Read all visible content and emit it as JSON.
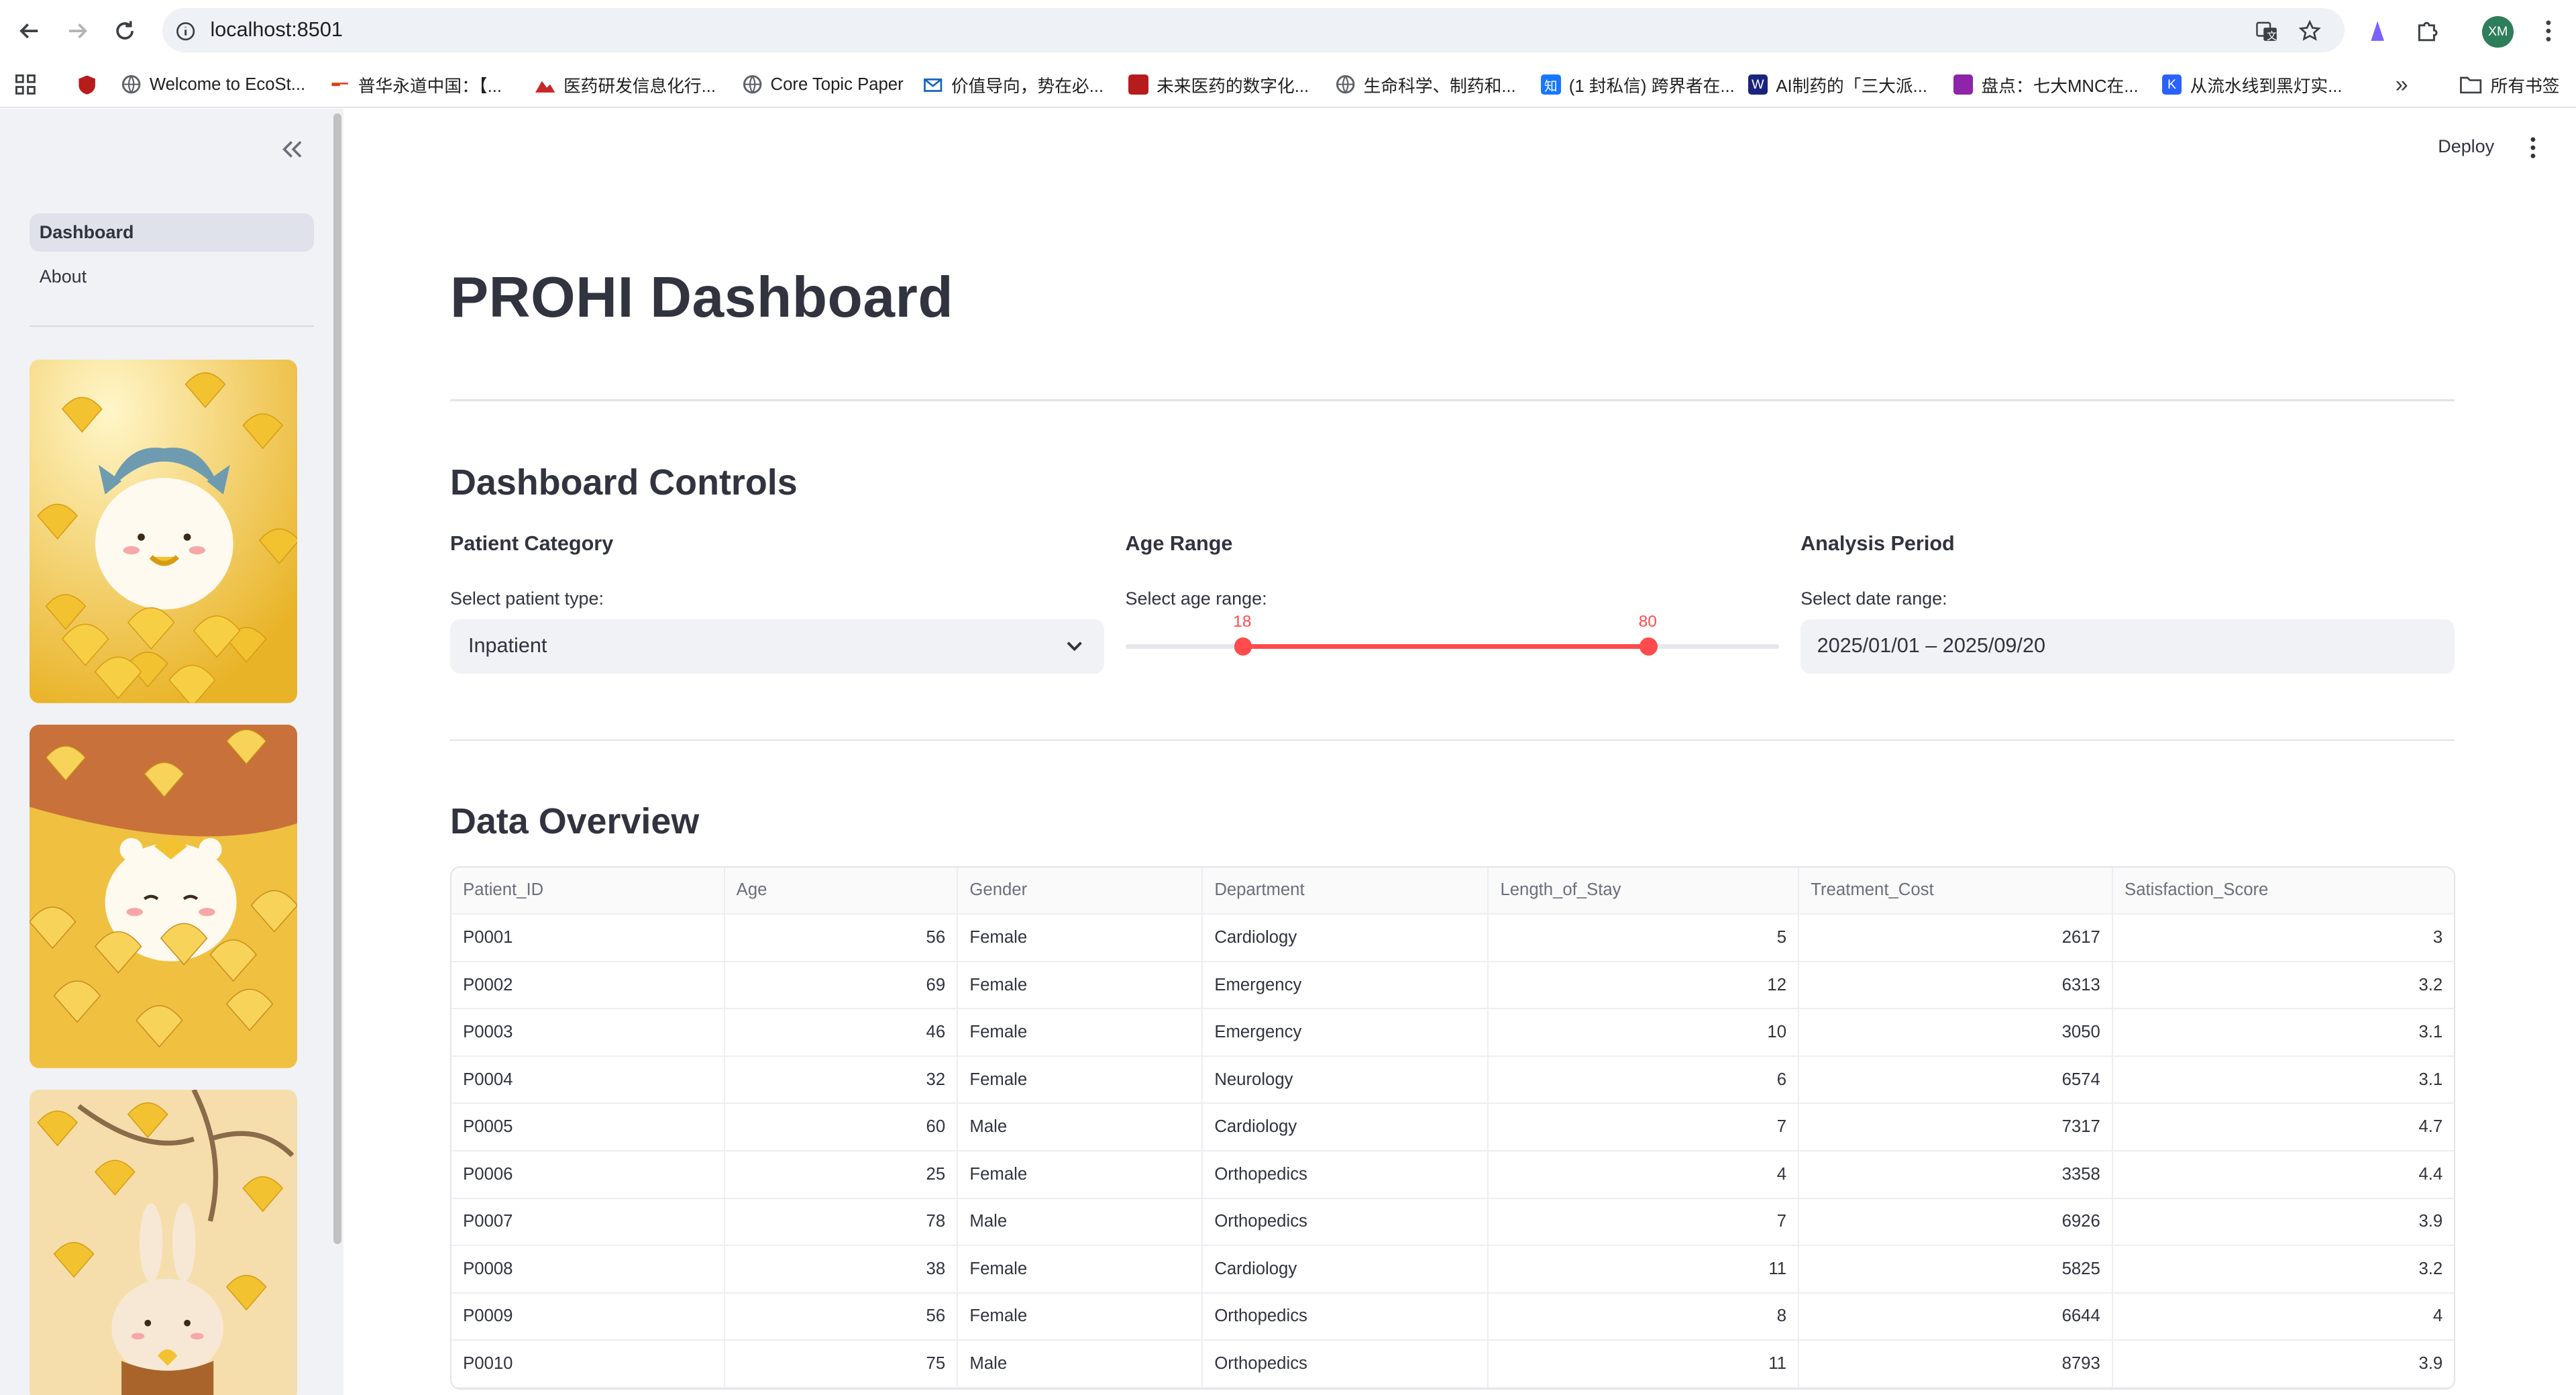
{
  "browser": {
    "url": "localhost:8501",
    "avatar_initials": "XM",
    "bookmarks": [
      {
        "label": "Welcome to EcoSt...",
        "icon": "globe-icon",
        "color": "#5f6368"
      },
      {
        "label": "普华永道中国：【...",
        "icon": "pwc-icon",
        "color": "#d93f0b"
      },
      {
        "label": "医药研发信息化行...",
        "icon": "mountain-icon",
        "color": "#c62828"
      },
      {
        "label": "Core Topic Paper",
        "icon": "globe-icon",
        "color": "#5f6368"
      },
      {
        "label": "价值导向，势在必...",
        "icon": "mail-icon",
        "color": "#1565c0"
      },
      {
        "label": "未来医药的数字化...",
        "icon": "logo-icon",
        "color": "#b71c1c"
      },
      {
        "label": "生命科学、制药和...",
        "icon": "globe-icon",
        "color": "#5f6368"
      },
      {
        "label": "(1 封私信) 跨界者在...",
        "icon": "zhihu-icon",
        "color": "#1677ff"
      },
      {
        "label": "AI制药的「三大派...",
        "icon": "w-icon",
        "color": "#1a237e"
      },
      {
        "label": "盘点：七大MNC在...",
        "icon": "logo-icon",
        "color": "#8e24aa"
      },
      {
        "label": "从流水线到黑灯实...",
        "icon": "k-icon",
        "color": "#2962ff"
      }
    ],
    "all_bookmarks": "所有书签"
  },
  "sidebar": {
    "nav": [
      {
        "label": "Dashboard",
        "active": true
      },
      {
        "label": "About",
        "active": false
      }
    ]
  },
  "header": {
    "deploy": "Deploy"
  },
  "main": {
    "title": "PROHI Dashboard",
    "controls_heading": "Dashboard Controls",
    "patient_category": {
      "heading": "Patient Category",
      "label": "Select patient type:",
      "value": "Inpatient"
    },
    "age_range": {
      "heading": "Age Range",
      "label": "Select age range:",
      "min": 0,
      "max": 100,
      "low": 18,
      "high": 80
    },
    "analysis_period": {
      "heading": "Analysis Period",
      "label": "Select date range:",
      "value": "2025/01/01 – 2025/09/20"
    },
    "overview_heading": "Data Overview",
    "table": {
      "columns": [
        "Patient_ID",
        "Age",
        "Gender",
        "Department",
        "Length_of_Stay",
        "Treatment_Cost",
        "Satisfaction_Score"
      ],
      "rows": [
        [
          "P0001",
          "56",
          "Female",
          "Cardiology",
          "5",
          "2617",
          "3"
        ],
        [
          "P0002",
          "69",
          "Female",
          "Emergency",
          "12",
          "6313",
          "3.2"
        ],
        [
          "P0003",
          "46",
          "Female",
          "Emergency",
          "10",
          "3050",
          "3.1"
        ],
        [
          "P0004",
          "32",
          "Female",
          "Neurology",
          "6",
          "6574",
          "3.1"
        ],
        [
          "P0005",
          "60",
          "Male",
          "Cardiology",
          "7",
          "7317",
          "4.7"
        ],
        [
          "P0006",
          "25",
          "Female",
          "Orthopedics",
          "4",
          "3358",
          "4.4"
        ],
        [
          "P0007",
          "78",
          "Male",
          "Orthopedics",
          "7",
          "6926",
          "3.9"
        ],
        [
          "P0008",
          "38",
          "Female",
          "Cardiology",
          "11",
          "5825",
          "3.2"
        ],
        [
          "P0009",
          "56",
          "Female",
          "Orthopedics",
          "8",
          "6644",
          "4"
        ],
        [
          "P0010",
          "75",
          "Male",
          "Orthopedics",
          "11",
          "8793",
          "3.9"
        ]
      ]
    }
  }
}
